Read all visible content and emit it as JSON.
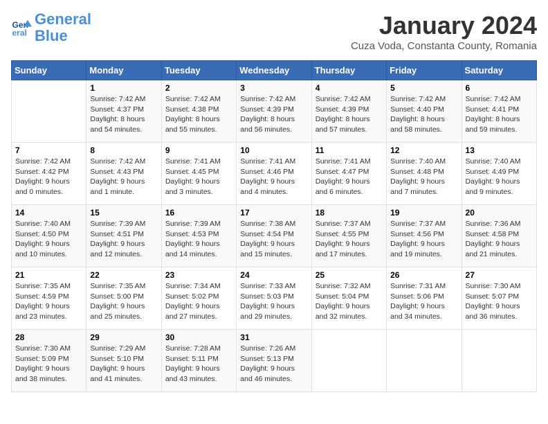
{
  "logo": {
    "line1": "General",
    "line2": "Blue"
  },
  "title": "January 2024",
  "subtitle": "Cuza Voda, Constanta County, Romania",
  "weekdays": [
    "Sunday",
    "Monday",
    "Tuesday",
    "Wednesday",
    "Thursday",
    "Friday",
    "Saturday"
  ],
  "weeks": [
    [
      {
        "day": "",
        "sunrise": "",
        "sunset": "",
        "daylight": ""
      },
      {
        "day": "1",
        "sunrise": "Sunrise: 7:42 AM",
        "sunset": "Sunset: 4:37 PM",
        "daylight": "Daylight: 8 hours and 54 minutes."
      },
      {
        "day": "2",
        "sunrise": "Sunrise: 7:42 AM",
        "sunset": "Sunset: 4:38 PM",
        "daylight": "Daylight: 8 hours and 55 minutes."
      },
      {
        "day": "3",
        "sunrise": "Sunrise: 7:42 AM",
        "sunset": "Sunset: 4:39 PM",
        "daylight": "Daylight: 8 hours and 56 minutes."
      },
      {
        "day": "4",
        "sunrise": "Sunrise: 7:42 AM",
        "sunset": "Sunset: 4:39 PM",
        "daylight": "Daylight: 8 hours and 57 minutes."
      },
      {
        "day": "5",
        "sunrise": "Sunrise: 7:42 AM",
        "sunset": "Sunset: 4:40 PM",
        "daylight": "Daylight: 8 hours and 58 minutes."
      },
      {
        "day": "6",
        "sunrise": "Sunrise: 7:42 AM",
        "sunset": "Sunset: 4:41 PM",
        "daylight": "Daylight: 8 hours and 59 minutes."
      }
    ],
    [
      {
        "day": "7",
        "sunrise": "Sunrise: 7:42 AM",
        "sunset": "Sunset: 4:42 PM",
        "daylight": "Daylight: 9 hours and 0 minutes."
      },
      {
        "day": "8",
        "sunrise": "Sunrise: 7:42 AM",
        "sunset": "Sunset: 4:43 PM",
        "daylight": "Daylight: 9 hours and 1 minute."
      },
      {
        "day": "9",
        "sunrise": "Sunrise: 7:41 AM",
        "sunset": "Sunset: 4:45 PM",
        "daylight": "Daylight: 9 hours and 3 minutes."
      },
      {
        "day": "10",
        "sunrise": "Sunrise: 7:41 AM",
        "sunset": "Sunset: 4:46 PM",
        "daylight": "Daylight: 9 hours and 4 minutes."
      },
      {
        "day": "11",
        "sunrise": "Sunrise: 7:41 AM",
        "sunset": "Sunset: 4:47 PM",
        "daylight": "Daylight: 9 hours and 6 minutes."
      },
      {
        "day": "12",
        "sunrise": "Sunrise: 7:40 AM",
        "sunset": "Sunset: 4:48 PM",
        "daylight": "Daylight: 9 hours and 7 minutes."
      },
      {
        "day": "13",
        "sunrise": "Sunrise: 7:40 AM",
        "sunset": "Sunset: 4:49 PM",
        "daylight": "Daylight: 9 hours and 9 minutes."
      }
    ],
    [
      {
        "day": "14",
        "sunrise": "Sunrise: 7:40 AM",
        "sunset": "Sunset: 4:50 PM",
        "daylight": "Daylight: 9 hours and 10 minutes."
      },
      {
        "day": "15",
        "sunrise": "Sunrise: 7:39 AM",
        "sunset": "Sunset: 4:51 PM",
        "daylight": "Daylight: 9 hours and 12 minutes."
      },
      {
        "day": "16",
        "sunrise": "Sunrise: 7:39 AM",
        "sunset": "Sunset: 4:53 PM",
        "daylight": "Daylight: 9 hours and 14 minutes."
      },
      {
        "day": "17",
        "sunrise": "Sunrise: 7:38 AM",
        "sunset": "Sunset: 4:54 PM",
        "daylight": "Daylight: 9 hours and 15 minutes."
      },
      {
        "day": "18",
        "sunrise": "Sunrise: 7:37 AM",
        "sunset": "Sunset: 4:55 PM",
        "daylight": "Daylight: 9 hours and 17 minutes."
      },
      {
        "day": "19",
        "sunrise": "Sunrise: 7:37 AM",
        "sunset": "Sunset: 4:56 PM",
        "daylight": "Daylight: 9 hours and 19 minutes."
      },
      {
        "day": "20",
        "sunrise": "Sunrise: 7:36 AM",
        "sunset": "Sunset: 4:58 PM",
        "daylight": "Daylight: 9 hours and 21 minutes."
      }
    ],
    [
      {
        "day": "21",
        "sunrise": "Sunrise: 7:35 AM",
        "sunset": "Sunset: 4:59 PM",
        "daylight": "Daylight: 9 hours and 23 minutes."
      },
      {
        "day": "22",
        "sunrise": "Sunrise: 7:35 AM",
        "sunset": "Sunset: 5:00 PM",
        "daylight": "Daylight: 9 hours and 25 minutes."
      },
      {
        "day": "23",
        "sunrise": "Sunrise: 7:34 AM",
        "sunset": "Sunset: 5:02 PM",
        "daylight": "Daylight: 9 hours and 27 minutes."
      },
      {
        "day": "24",
        "sunrise": "Sunrise: 7:33 AM",
        "sunset": "Sunset: 5:03 PM",
        "daylight": "Daylight: 9 hours and 29 minutes."
      },
      {
        "day": "25",
        "sunrise": "Sunrise: 7:32 AM",
        "sunset": "Sunset: 5:04 PM",
        "daylight": "Daylight: 9 hours and 32 minutes."
      },
      {
        "day": "26",
        "sunrise": "Sunrise: 7:31 AM",
        "sunset": "Sunset: 5:06 PM",
        "daylight": "Daylight: 9 hours and 34 minutes."
      },
      {
        "day": "27",
        "sunrise": "Sunrise: 7:30 AM",
        "sunset": "Sunset: 5:07 PM",
        "daylight": "Daylight: 9 hours and 36 minutes."
      }
    ],
    [
      {
        "day": "28",
        "sunrise": "Sunrise: 7:30 AM",
        "sunset": "Sunset: 5:09 PM",
        "daylight": "Daylight: 9 hours and 38 minutes."
      },
      {
        "day": "29",
        "sunrise": "Sunrise: 7:29 AM",
        "sunset": "Sunset: 5:10 PM",
        "daylight": "Daylight: 9 hours and 41 minutes."
      },
      {
        "day": "30",
        "sunrise": "Sunrise: 7:28 AM",
        "sunset": "Sunset: 5:11 PM",
        "daylight": "Daylight: 9 hours and 43 minutes."
      },
      {
        "day": "31",
        "sunrise": "Sunrise: 7:26 AM",
        "sunset": "Sunset: 5:13 PM",
        "daylight": "Daylight: 9 hours and 46 minutes."
      },
      {
        "day": "",
        "sunrise": "",
        "sunset": "",
        "daylight": ""
      },
      {
        "day": "",
        "sunrise": "",
        "sunset": "",
        "daylight": ""
      },
      {
        "day": "",
        "sunrise": "",
        "sunset": "",
        "daylight": ""
      }
    ]
  ]
}
